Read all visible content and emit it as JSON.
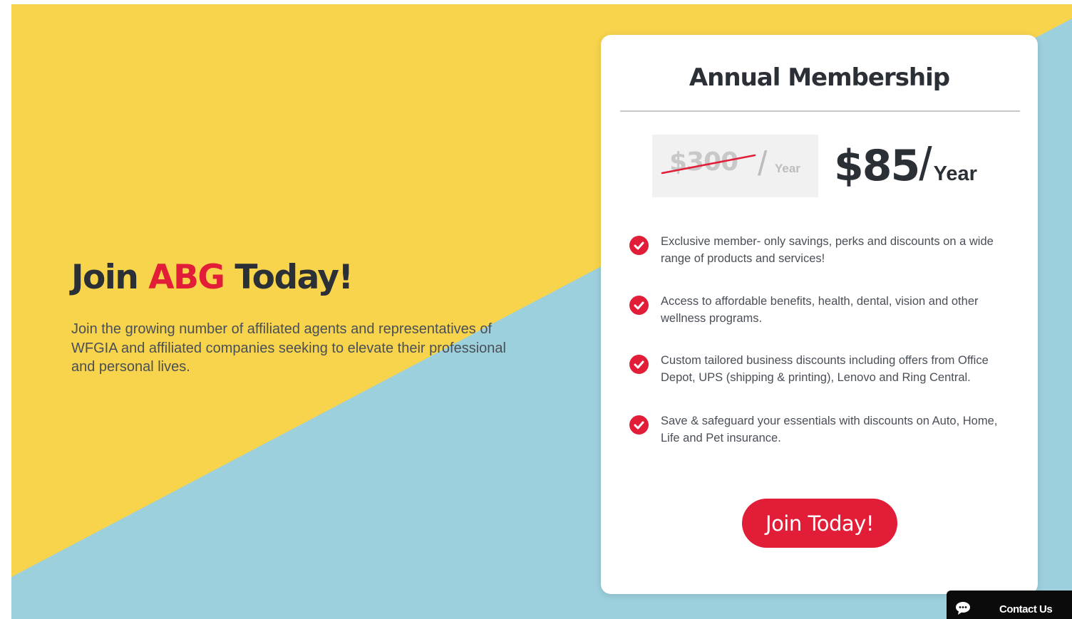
{
  "theme": {
    "yellow": "#F7D44C",
    "blue": "#9CD0DD",
    "accent_red": "#E11D37",
    "dark_text": "#2B2F36"
  },
  "hero": {
    "title_prefix": "Join ",
    "title_brand": "ABG",
    "title_suffix": " Today!",
    "description": "Join the growing number of affiliated agents and representatives of WFGIA and affiliated companies seeking to elevate their professional and personal lives."
  },
  "membership": {
    "title": "Annual Membership",
    "old_price": {
      "amount": "$300",
      "slash": "/",
      "period": "Year"
    },
    "new_price": {
      "amount": "$85",
      "slash": "/",
      "period": "Year"
    },
    "features": [
      {
        "icon": "check-circle-icon",
        "text": "Exclusive member- only savings, perks and discounts on a wide range of products and services!"
      },
      {
        "icon": "check-circle-icon",
        "text": "Access to affordable benefits, health, dental, vision and other wellness programs."
      },
      {
        "icon": "check-circle-icon",
        "text": "Custom tailored business discounts including offers from Office Depot, UPS (shipping & printing), Lenovo and Ring Central."
      },
      {
        "icon": "check-circle-icon",
        "text": "Save & safeguard your essentials with discounts on Auto, Home, Life and Pet insurance."
      }
    ],
    "cta_label": "Join Today!"
  },
  "contact_widget": {
    "icon": "chat-bubble-icon",
    "label": "Contact Us"
  }
}
